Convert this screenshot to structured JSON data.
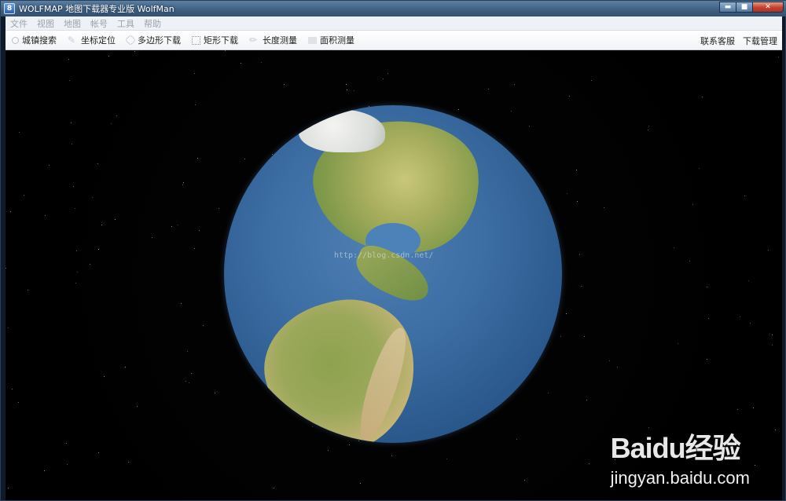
{
  "window": {
    "title": "WOLFMAP 地图下载器专业版   WolfMan",
    "app_icon_text": "8",
    "controls": {
      "minimize": "▬",
      "maximize": "■",
      "close": "✕"
    }
  },
  "menu": [
    "文件",
    "视图",
    "地图",
    "帐号",
    "工具",
    "帮助"
  ],
  "toolbar": {
    "left": [
      {
        "label": "城镇搜索",
        "icon": "search-icon"
      },
      {
        "label": "坐标定位",
        "icon": "pin-icon"
      },
      {
        "label": "多边形下载",
        "icon": "polygon-icon"
      },
      {
        "label": "矩形下载",
        "icon": "rectangle-icon"
      },
      {
        "label": "长度测量",
        "icon": "ruler-icon"
      },
      {
        "label": "面积测量",
        "icon": "area-icon"
      }
    ],
    "right": [
      "联系客服",
      "下载管理"
    ]
  },
  "map": {
    "watermark": "http://blog.csdn.net/"
  },
  "overlay": {
    "brand_text": "Baidu经验",
    "brand_sub": "jingyan.baidu.com"
  }
}
